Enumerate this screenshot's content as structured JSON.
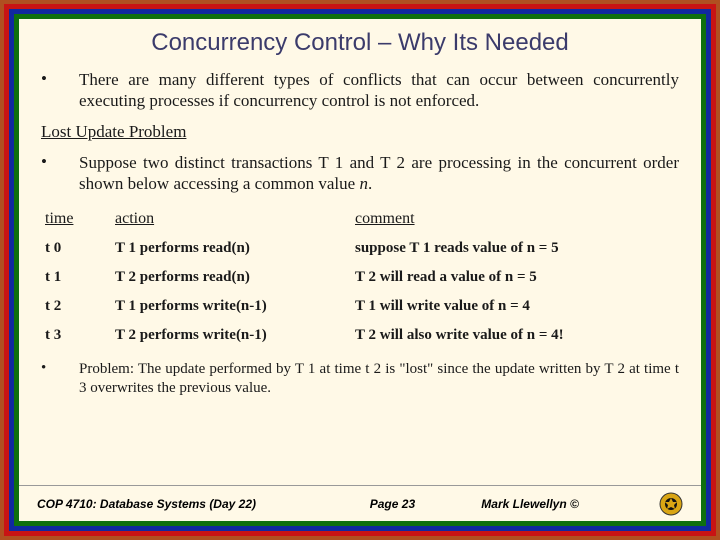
{
  "title": "Concurrency Control – Why Its Needed",
  "bullet1": "There are many different types of conflicts that can occur between concurrently executing processes if concurrency control is not enforced.",
  "subhead": "Lost Update Problem",
  "bullet2_prefix": "Suppose two distinct transactions T 1 and T 2 are processing in the concurrent order shown below accessing a common value ",
  "bullet2_var": "n",
  "bullet2_suffix": ".",
  "table": {
    "headers": {
      "time": "time",
      "action": "action",
      "comment": "comment"
    },
    "rows": [
      {
        "time": "t 0",
        "action": "T 1 performs read(n)",
        "comment": "suppose T 1 reads value of n = 5"
      },
      {
        "time": "t 1",
        "action": "T 2 performs read(n)",
        "comment": "T 2 will read a value of n = 5"
      },
      {
        "time": "t 2",
        "action": "T 1 performs write(n-1)",
        "comment": "T 1 will write value of n = 4"
      },
      {
        "time": "t 3",
        "action": "T 2 performs write(n-1)",
        "comment": "T 2 will also write value of n = 4!"
      }
    ]
  },
  "problem": "Problem:  The update performed by T 1 at time t 2 is \"lost\" since the update written by T 2 at time t 3 overwrites the previous value.",
  "footer": {
    "left": "COP 4710: Database Systems  (Day 22)",
    "mid": "Page 23",
    "right": "Mark Llewellyn ©"
  }
}
